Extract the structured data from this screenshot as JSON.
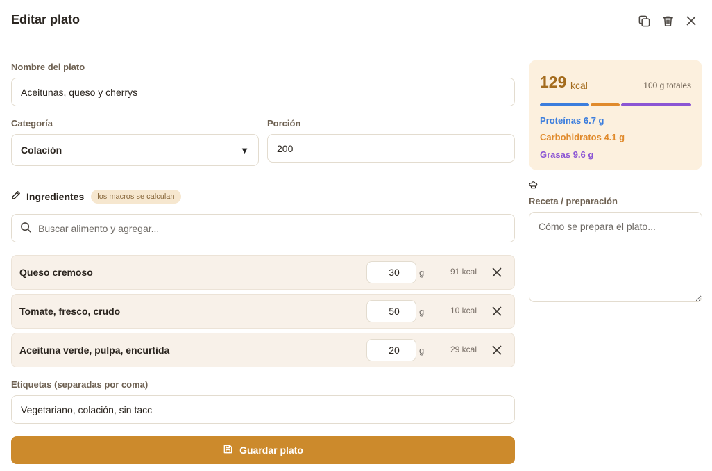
{
  "header": {
    "title": "Editar plato"
  },
  "form": {
    "name_label": "Nombre del plato",
    "name_value": "Aceitunas, queso y cherrys",
    "category_label": "Categoría",
    "category_value": "Colación",
    "portion_label": "Porción",
    "portion_value": "200"
  },
  "ingredients": {
    "title": "Ingredientes",
    "chip": "los macros se calculan",
    "search_placeholder": "Buscar alimento y agregar...",
    "unit": "g",
    "items": [
      {
        "name": "Queso cremoso",
        "qty": "30",
        "kcal": "91 kcal"
      },
      {
        "name": "Tomate, fresco, crudo",
        "qty": "50",
        "kcal": "10 kcal"
      },
      {
        "name": "Aceituna verde, pulpa, encurtida",
        "qty": "20",
        "kcal": "29 kcal"
      }
    ]
  },
  "tags": {
    "label": "Etiquetas (separadas por coma)",
    "value": "Vegetariano, colación, sin tacc"
  },
  "save_label": "Guardar plato",
  "macros": {
    "kcal": "129",
    "kcal_unit": "kcal",
    "total": "100 g totales",
    "protein": "Proteínas 6.7 g",
    "carbs": "Carbohidratos 4.1 g",
    "fat": "Grasas 9.6 g",
    "protein_share": 0.33,
    "carbs_share": 0.2,
    "fat_share": 0.47,
    "protein_color": "#3b7ddd",
    "carbs_color": "#e08a2c",
    "fat_color": "#8b55d4"
  },
  "recipe": {
    "label": "Receta / preparación",
    "placeholder": "Cómo se prepara el plato..."
  }
}
